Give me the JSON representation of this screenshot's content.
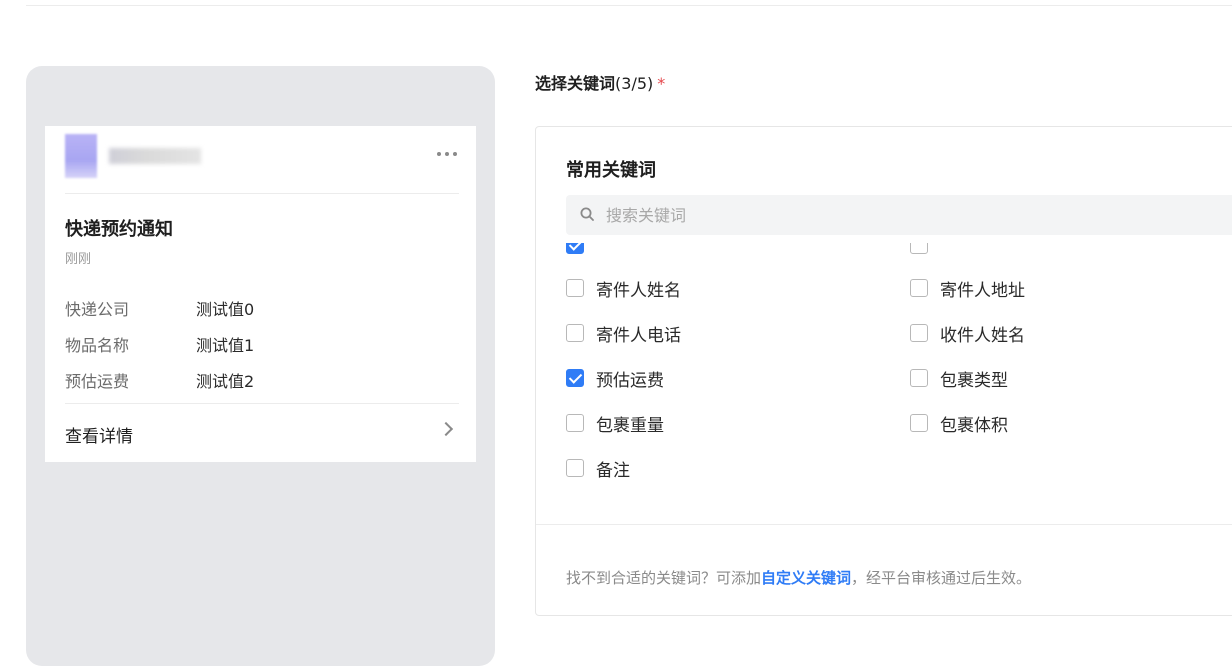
{
  "preview": {
    "card": {
      "title": "快递预约通知",
      "time": "刚刚",
      "rows": [
        {
          "key": "快递公司",
          "value": "测试值0"
        },
        {
          "key": "物品名称",
          "value": "测试值1"
        },
        {
          "key": "预估运费",
          "value": "测试值2"
        }
      ],
      "footer_link": "查看详情"
    }
  },
  "selection": {
    "title": "选择关键词",
    "count": "(3/5)",
    "required_mark": "*",
    "heading": "常用关键词",
    "search_placeholder": "搜索关键词",
    "keywords": [
      {
        "label": "寄件人姓名",
        "checked": false
      },
      {
        "label": "寄件人地址",
        "checked": false
      },
      {
        "label": "寄件人电话",
        "checked": false
      },
      {
        "label": "收件人姓名",
        "checked": false
      },
      {
        "label": "预估运费",
        "checked": true
      },
      {
        "label": "包裹类型",
        "checked": false
      },
      {
        "label": "包裹重量",
        "checked": false
      },
      {
        "label": "包裹体积",
        "checked": false
      },
      {
        "label": "备注",
        "checked": false
      }
    ],
    "hint_prefix": "找不到合适的关键词？可添加",
    "hint_link": "自定义关键词",
    "hint_suffix": "，经平台审核通过后生效。"
  },
  "colors": {
    "accent": "#2f7cf6",
    "required": "#e5484d",
    "panel_bg": "#e6e7ea"
  }
}
